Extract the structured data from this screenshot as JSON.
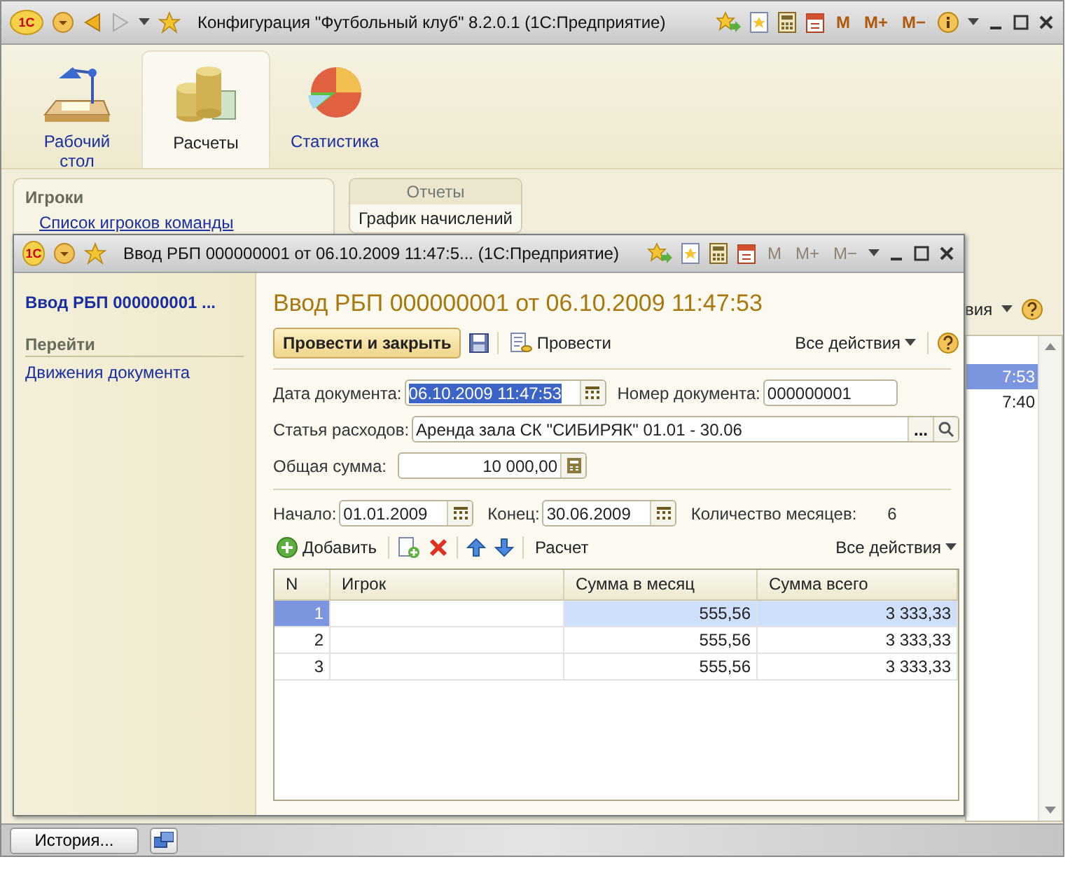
{
  "main_window": {
    "logo": "1С",
    "title": "Конфигурация \"Футбольный клуб\" 8.2.0.1  (1С:Предприятие)",
    "memory_buttons": [
      "M",
      "M+",
      "M−"
    ]
  },
  "sections": [
    {
      "label": "Рабочий стол",
      "kind": "desk",
      "selected": false
    },
    {
      "label": "Расчеты",
      "kind": "coins",
      "selected": true
    },
    {
      "label": "Статистика",
      "kind": "chart",
      "selected": false
    }
  ],
  "nav_panel": {
    "heading": "Игроки",
    "links": [
      "Список игроков команды"
    ]
  },
  "reports_group": {
    "title": "Отчеты",
    "items": [
      "График начислений"
    ]
  },
  "background_list": {
    "actions_label": "вия",
    "rows": [
      {
        "text": "7:53",
        "selected": true
      },
      {
        "text": "7:40",
        "selected": false
      }
    ]
  },
  "bottom_bar": {
    "history_button": "История..."
  },
  "document_window": {
    "logo": "1С",
    "title": "Ввод РБП 000000001 от 06.10.2009 11:47:5...  (1С:Предприятие)",
    "memory_buttons": [
      "M",
      "M+",
      "M−"
    ],
    "memory_disabled": true,
    "nav": {
      "title": "Ввод РБП 000000001 ...",
      "group": "Перейти",
      "links": [
        "Движения документа"
      ]
    },
    "heading": "Ввод РБП 000000001 от 06.10.2009 11:47:53",
    "toolbar": {
      "primary": "Провести и закрыть",
      "post": "Провести",
      "all_actions": "Все действия"
    },
    "date": {
      "label": "Дата документа:",
      "value": "06.10.2009 11:47:53"
    },
    "number": {
      "label": "Номер документа:",
      "value": "000000001"
    },
    "expense": {
      "label": "Статья расходов:",
      "value": "Аренда зала СК \"СИБИРЯК\" 01.01 - 30.06",
      "choose": "..."
    },
    "total": {
      "label": "Общая сумма:",
      "value": "10 000,00"
    },
    "start": {
      "label": "Начало:",
      "value": "01.01.2009"
    },
    "end": {
      "label": "Конец:",
      "value": "30.06.2009"
    },
    "months": {
      "label": "Количество месяцев:",
      "value": "6"
    },
    "table_toolbar": {
      "add": "Добавить",
      "calc": "Расчет",
      "all_actions": "Все действия"
    },
    "table": {
      "columns": [
        "N",
        "Игрок",
        "Сумма в месяц",
        "Сумма всего"
      ],
      "rows": [
        {
          "n": "1",
          "per_month": "555,56",
          "total": "3 333,33",
          "selected": true
        },
        {
          "n": "2",
          "per_month": "555,56",
          "total": "3 333,33",
          "selected": false
        },
        {
          "n": "3",
          "per_month": "555,56",
          "total": "3 333,33",
          "selected": false
        }
      ]
    }
  }
}
